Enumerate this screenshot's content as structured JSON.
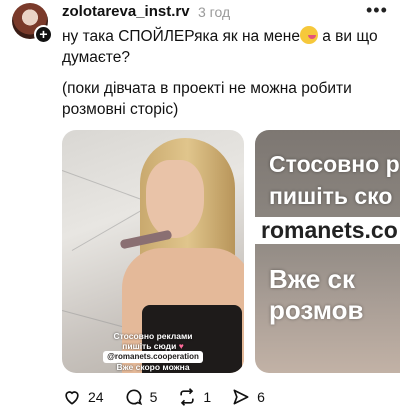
{
  "post": {
    "username": "zolotareva_inst.rv",
    "time": "3 год",
    "more_icon": "more-horizontal-icon",
    "text_line1": "ну така СПОЙЛЕРяка як на мене",
    "text_line1_end": " а ви що думаєте?",
    "text_line2": "(поки дівчата в проекті не можна робити розмовні сторіс)"
  },
  "media1": {
    "caption_line1": "Стосовно реклами",
    "caption_line2": "пишіть сюди",
    "caption_link": "@romanets.cooperation",
    "caption_bottom": "Вже скоро можна"
  },
  "media2": {
    "line1": "Стосовно р",
    "line2": "пишіть ско",
    "link": "romanets.co",
    "line4": "Вже ск",
    "line5": "розмов"
  },
  "actions": {
    "likes": "24",
    "comments": "5",
    "reposts": "1",
    "shares": "6"
  },
  "colors": {
    "text": "#111111",
    "muted": "#9a9a9a"
  }
}
